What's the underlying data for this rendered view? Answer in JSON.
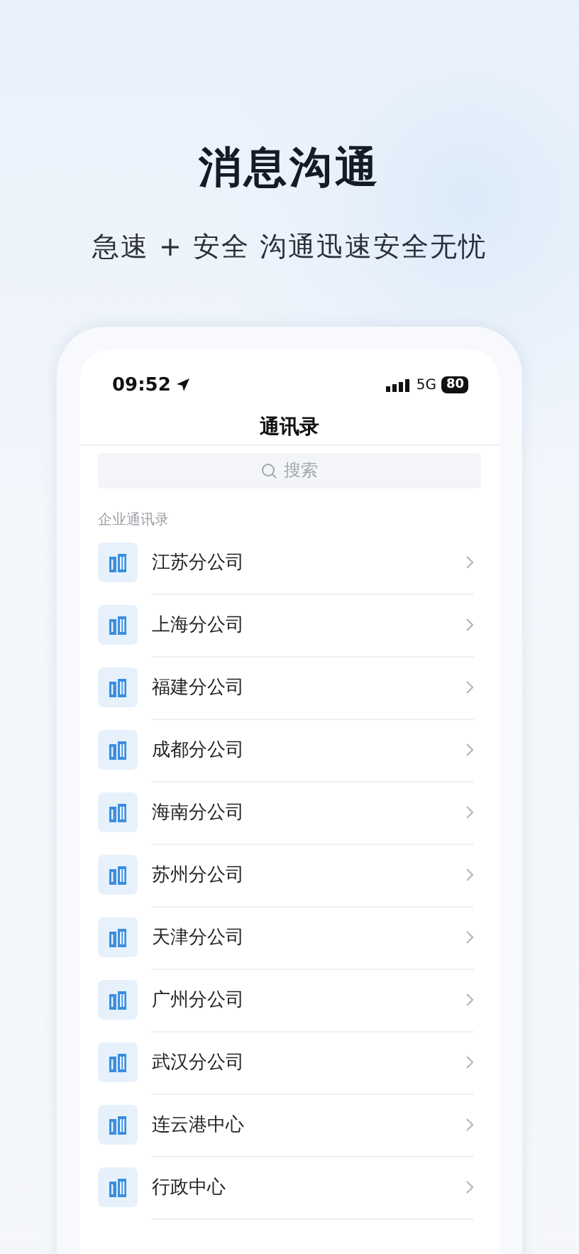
{
  "headline": "消息沟通",
  "subtitle": "急速 + 安全 沟通迅速安全无忧",
  "status_bar": {
    "time": "09:52",
    "network": "5G",
    "battery": "80"
  },
  "nav_title": "通讯录",
  "search": {
    "placeholder": "搜索"
  },
  "section_label": "企业通讯录",
  "contacts": [
    {
      "name": "江苏分公司"
    },
    {
      "name": "上海分公司"
    },
    {
      "name": "福建分公司"
    },
    {
      "name": "成都分公司"
    },
    {
      "name": "海南分公司"
    },
    {
      "name": "苏州分公司"
    },
    {
      "name": "天津分公司"
    },
    {
      "name": "广州分公司"
    },
    {
      "name": "武汉分公司"
    },
    {
      "name": "连云港中心"
    },
    {
      "name": "行政中心"
    }
  ]
}
